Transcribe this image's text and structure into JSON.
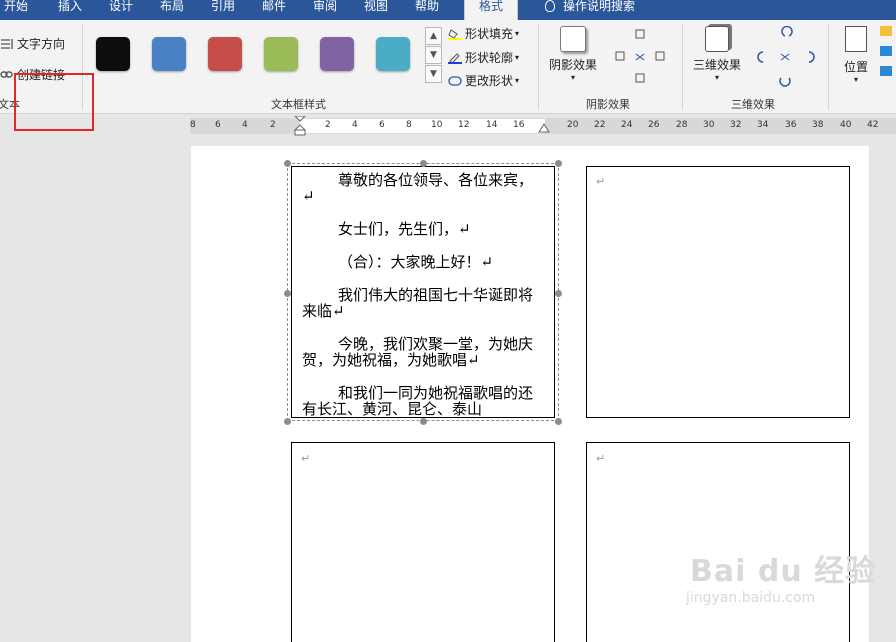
{
  "tabs": [
    "开始",
    "插入",
    "设计",
    "布局",
    "引用",
    "邮件",
    "审阅",
    "视图",
    "帮助",
    "格式"
  ],
  "active_tab": "格式",
  "search_tab": "操作说明搜索",
  "text_group": {
    "text_direction": "文字方向",
    "create_link": "创建链接",
    "label": "文本"
  },
  "textbox_styles": {
    "label": "文本框样式",
    "swatch_colors": [
      "#0d0d0d",
      "#4a80c4",
      "#c54e4b",
      "#9bbb59",
      "#8064a2",
      "#4bacc6"
    ],
    "shape_fill": "形状填充",
    "shape_outline": "形状轮廓",
    "change_shape": "更改形状"
  },
  "shadow_group": {
    "button": "阴影效果",
    "label": "阴影效果"
  },
  "threed_group": {
    "button": "三维效果",
    "label": "三维效果"
  },
  "position_button": "位置",
  "ruler_numbers": [
    "8",
    "6",
    "4",
    "2",
    "2",
    "4",
    "6",
    "8",
    "10",
    "12",
    "14",
    "16",
    "20",
    "22",
    "24",
    "26",
    "28",
    "30",
    "32",
    "34",
    "36",
    "38",
    "40",
    "42"
  ],
  "document": {
    "paragraph_mark": "↵",
    "paragraphs": [
      "尊敬的各位领导、各位来宾，↵",
      "女士们，先生们，↵",
      "（合）：大家晚上好！↵",
      "我们伟大的祖国七十华诞即将来临↵",
      "今晚，我们欢聚一堂，为她庆贺，为她祝福，为她歌唱↵",
      "和我们一同为她祝福歌唱的还有长江、黄河、昆仑、泰山"
    ]
  },
  "watermark": {
    "logo": "Bai du 经验",
    "url": "jingyan.baidu.com"
  }
}
